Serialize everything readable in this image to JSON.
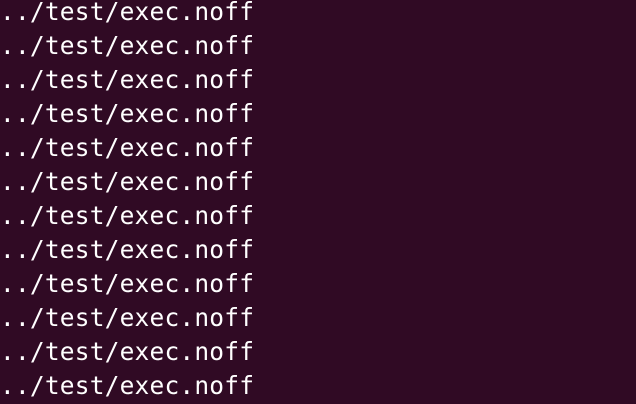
{
  "terminal": {
    "background": "#300a24",
    "foreground": "#ffffff",
    "lines": [
      "../test/exec.noff",
      "../test/exec.noff",
      "../test/exec.noff",
      "../test/exec.noff",
      "../test/exec.noff",
      "../test/exec.noff",
      "../test/exec.noff",
      "../test/exec.noff",
      "../test/exec.noff",
      "../test/exec.noff",
      "../test/exec.noff",
      "../test/exec.noff"
    ]
  }
}
